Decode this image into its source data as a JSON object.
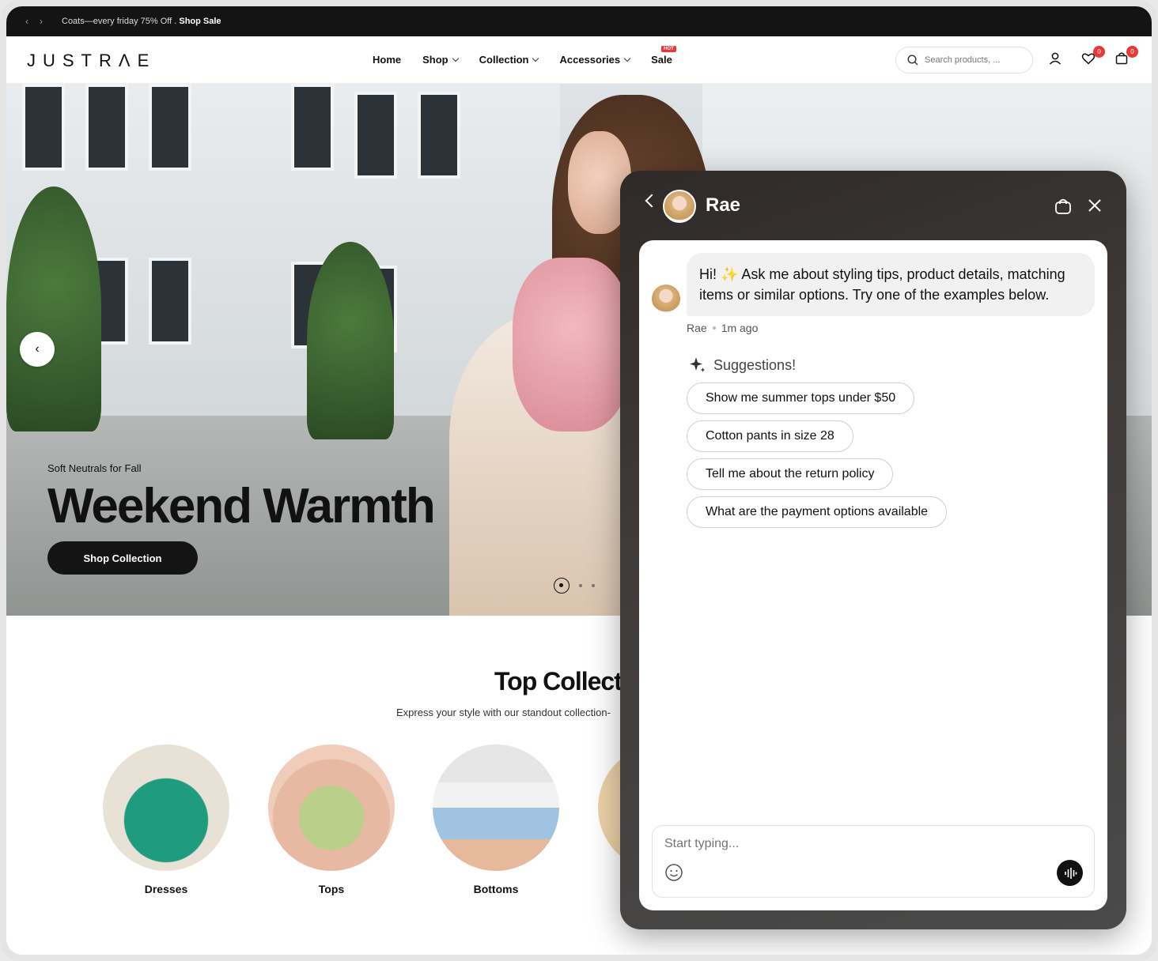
{
  "announcement": {
    "message": "Coats—every friday 75% Off . ",
    "link": "Shop Sale"
  },
  "header": {
    "logo": "JUSTRΛE",
    "nav": [
      {
        "label": "Home"
      },
      {
        "label": "Shop"
      },
      {
        "label": "Collection"
      },
      {
        "label": "Accessories"
      },
      {
        "label": "Sale",
        "badge": "HOT"
      }
    ],
    "search_placeholder": "Search products, ...",
    "wishlist_count": "0",
    "cart_count": "0"
  },
  "hero": {
    "tagline": "Soft Neutrals for Fall",
    "title": "Weekend Warmth",
    "cta": "Shop Collection"
  },
  "collections": {
    "title": "Top Collect",
    "subtitle": "Express your style with our standout collection-",
    "items": [
      {
        "label": "Dresses"
      },
      {
        "label": "Tops"
      },
      {
        "label": "Bottoms"
      }
    ]
  },
  "chat": {
    "agent_name": "Rae",
    "greeting": "Hi! ✨ Ask me about styling tips, product details, matching items or similar options. Try one of the examples below.",
    "meta_name": "Rae",
    "meta_time": "1m ago",
    "suggestions_title": "Suggestions!",
    "suggestions": [
      "Show me summer tops under $50",
      "Cotton pants in size 28",
      "Tell me about the return policy",
      "What are the payment options available"
    ],
    "input_placeholder": "Start typing..."
  },
  "colors": {
    "accent": "#141414",
    "badge": "#e53935",
    "chat_bg": "#3e3b39"
  }
}
